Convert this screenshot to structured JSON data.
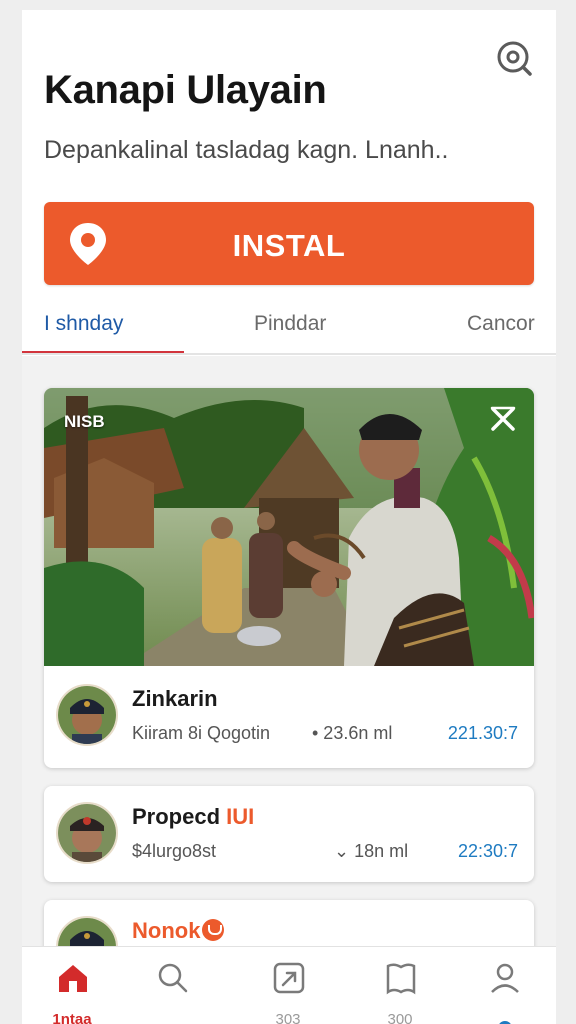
{
  "header": {
    "title": "Kanapi Ulayain",
    "subtitle": "Depankalinal tasladag kagn. Lnanh..",
    "install_label": "INSTAL"
  },
  "tabs": [
    {
      "label": "I shnday",
      "active": true
    },
    {
      "label": "Pinddar",
      "active": false
    },
    {
      "label": "Cancor",
      "active": false
    }
  ],
  "featured": {
    "badge": "NISB",
    "rows": [
      {
        "name": "Zinkarin",
        "highlight": "",
        "subtitle": "Kiiram 8i Qogotin",
        "distance": "• 23.6n ml",
        "time": "221.30:7"
      }
    ]
  },
  "list": [
    {
      "name": "Propecd ",
      "highlight": "IUI",
      "subtitle": "$4lurgo8st",
      "distance": "⌄ 18n ml",
      "time": "22:30:7"
    },
    {
      "name": "",
      "highlight": "Nonok",
      "subtitle": "",
      "distance": "",
      "time": ""
    }
  ],
  "nav": [
    {
      "label": "1ntaa",
      "icon": "home-icon",
      "active": true
    },
    {
      "label": "",
      "icon": "search-icon",
      "active": false
    },
    {
      "label": "303",
      "icon": "share-box-icon",
      "active": false
    },
    {
      "label": "300",
      "icon": "bookmark-icon",
      "active": false
    },
    {
      "label": "",
      "icon": "profile-icon",
      "active": false
    }
  ],
  "colors": {
    "accent": "#ec5a2c",
    "tab_active": "#1f5aa6",
    "underline": "#d2343c",
    "time": "#1e7bc1",
    "nav_active": "#d32b2b"
  }
}
